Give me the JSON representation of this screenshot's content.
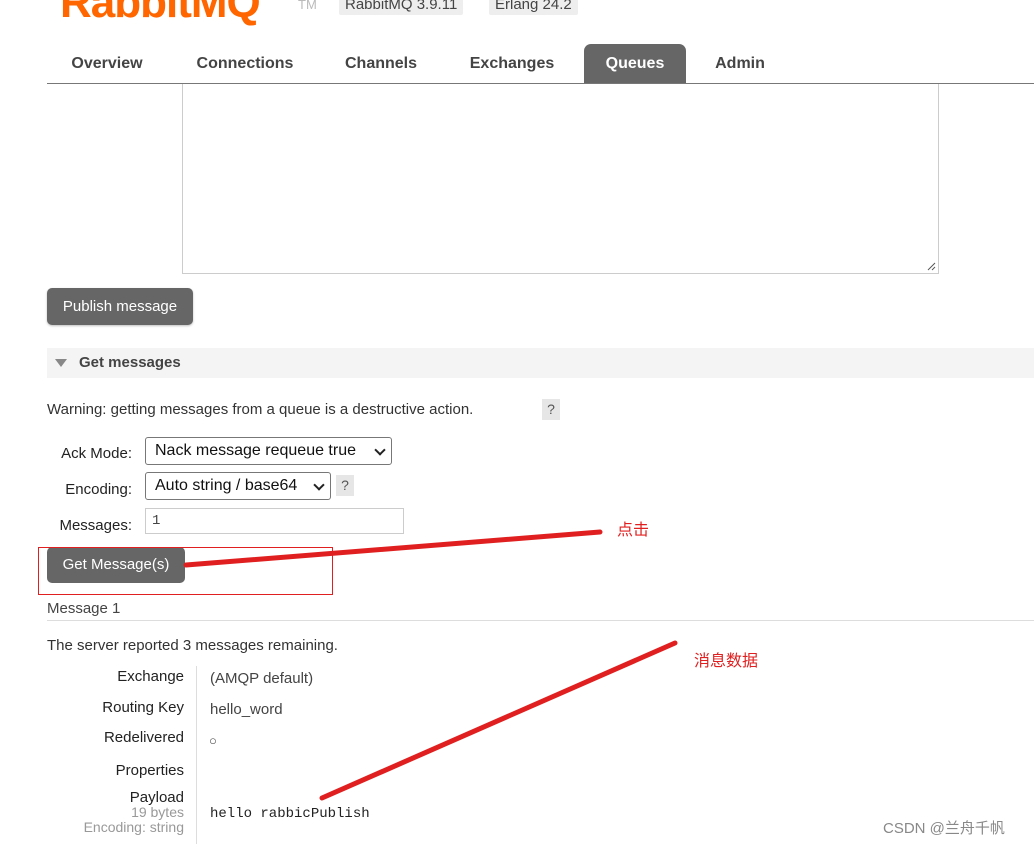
{
  "header": {
    "logo_text": "RabbitMQ",
    "tm": "TM",
    "version_badge": "RabbitMQ 3.9.11",
    "erlang_badge": "Erlang 24.2"
  },
  "tabs": [
    {
      "label": "Overview"
    },
    {
      "label": "Connections"
    },
    {
      "label": "Channels"
    },
    {
      "label": "Exchanges"
    },
    {
      "label": "Queues",
      "active": true
    },
    {
      "label": "Admin"
    }
  ],
  "publish": {
    "button_label": "Publish message"
  },
  "get_messages": {
    "section_title": "Get messages",
    "warning": "Warning: getting messages from a queue is a destructive action.",
    "help": "?",
    "ack_mode_label": "Ack Mode:",
    "ack_mode_value": "Nack message requeue true",
    "encoding_label": "Encoding:",
    "encoding_value": "Auto string / base64",
    "messages_label": "Messages:",
    "messages_value": "1",
    "button_label": "Get Message(s)"
  },
  "result": {
    "message_title": "Message 1",
    "remaining_text": "The server reported 3 messages remaining.",
    "exchange_label": "Exchange",
    "exchange_value": "(AMQP default)",
    "routing_key_label": "Routing Key",
    "routing_key_value": "hello_word",
    "redelivered_label": "Redelivered",
    "redelivered_value": "○",
    "properties_label": "Properties",
    "payload_label": "Payload",
    "payload_size": "19 bytes",
    "payload_encoding": "Encoding: string",
    "payload_value": "hello rabbicPublish"
  },
  "annotations": {
    "click_note": "点击",
    "data_note": "消息数据"
  },
  "watermark": "CSDN @兰舟千帆",
  "colors": {
    "brand": "#ff6600",
    "tab_active": "#666666",
    "annotation_red": "#e02020"
  }
}
